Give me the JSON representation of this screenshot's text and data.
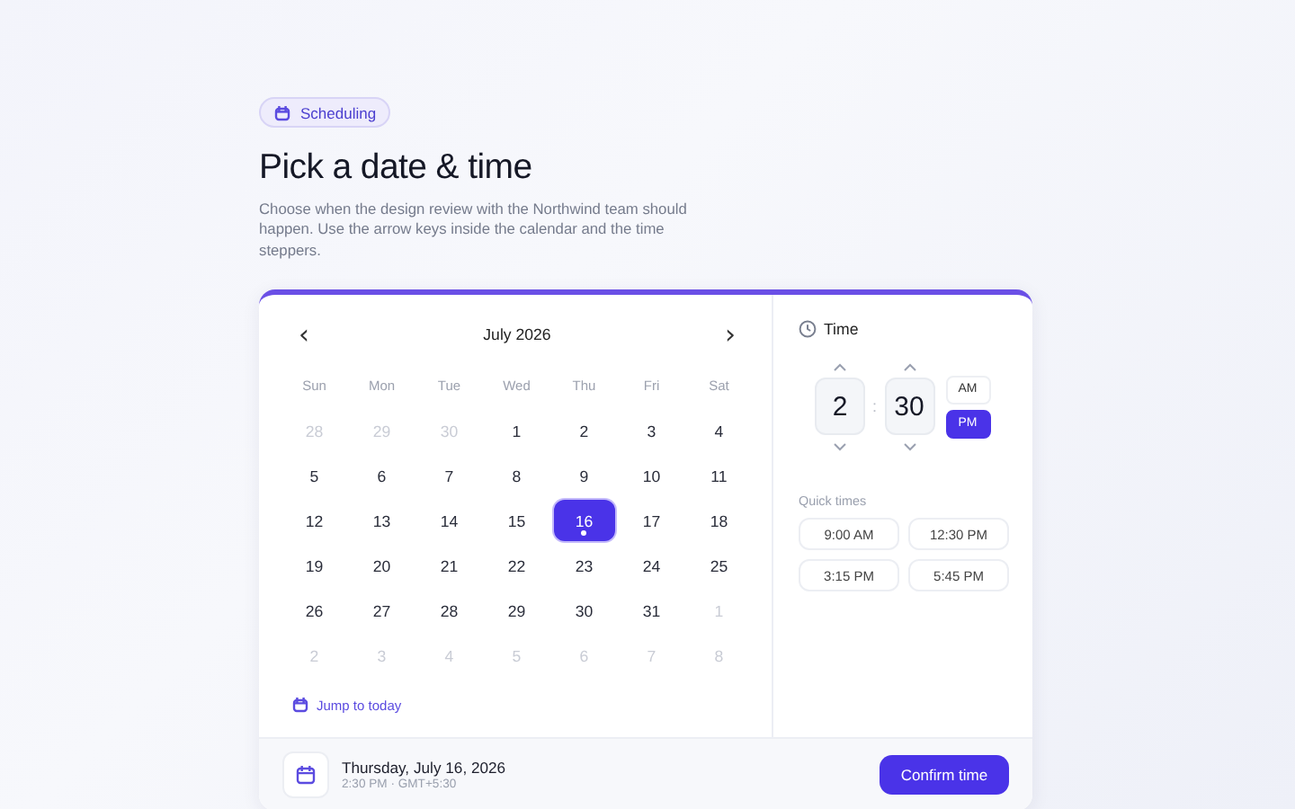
{
  "badge": {
    "label": "Scheduling"
  },
  "title": "Pick a date & time",
  "description": "Choose when the design review with the Northwind team should happen. Use the arrow keys inside the calendar and the time steppers.",
  "calendar": {
    "month": "July 2026",
    "prev": "‹",
    "next": "›",
    "weekdays": [
      "Sun",
      "Mon",
      "Tue",
      "Wed",
      "Thu",
      "Fri",
      "Sat"
    ],
    "weeks": [
      [
        {
          "day": "28",
          "outside": true,
          "selected": false
        },
        {
          "day": "29",
          "outside": true,
          "selected": false
        },
        {
          "day": "30",
          "outside": true,
          "selected": false
        },
        {
          "day": "1",
          "outside": false,
          "selected": false
        },
        {
          "day": "2",
          "outside": false,
          "selected": false
        },
        {
          "day": "3",
          "outside": false,
          "selected": false
        },
        {
          "day": "4",
          "outside": false,
          "selected": false
        }
      ],
      [
        {
          "day": "5",
          "outside": false,
          "selected": false
        },
        {
          "day": "6",
          "outside": false,
          "selected": false
        },
        {
          "day": "7",
          "outside": false,
          "selected": false
        },
        {
          "day": "8",
          "outside": false,
          "selected": false
        },
        {
          "day": "9",
          "outside": false,
          "selected": false
        },
        {
          "day": "10",
          "outside": false,
          "selected": false
        },
        {
          "day": "11",
          "outside": false,
          "selected": false
        }
      ],
      [
        {
          "day": "12",
          "outside": false,
          "selected": false
        },
        {
          "day": "13",
          "outside": false,
          "selected": false
        },
        {
          "day": "14",
          "outside": false,
          "selected": false
        },
        {
          "day": "15",
          "outside": false,
          "selected": false
        },
        {
          "day": "16",
          "outside": false,
          "selected": true
        },
        {
          "day": "17",
          "outside": false,
          "selected": false
        },
        {
          "day": "18",
          "outside": false,
          "selected": false
        }
      ],
      [
        {
          "day": "19",
          "outside": false,
          "selected": false
        },
        {
          "day": "20",
          "outside": false,
          "selected": false
        },
        {
          "day": "21",
          "outside": false,
          "selected": false
        },
        {
          "day": "22",
          "outside": false,
          "selected": false
        },
        {
          "day": "23",
          "outside": false,
          "selected": false
        },
        {
          "day": "24",
          "outside": false,
          "selected": false
        },
        {
          "day": "25",
          "outside": false,
          "selected": false
        }
      ],
      [
        {
          "day": "26",
          "outside": false,
          "selected": false
        },
        {
          "day": "27",
          "outside": false,
          "selected": false
        },
        {
          "day": "28",
          "outside": false,
          "selected": false
        },
        {
          "day": "29",
          "outside": false,
          "selected": false
        },
        {
          "day": "30",
          "outside": false,
          "selected": false
        },
        {
          "day": "31",
          "outside": false,
          "selected": false
        },
        {
          "day": "1",
          "outside": true,
          "selected": false
        }
      ],
      [
        {
          "day": "2",
          "outside": true,
          "selected": false
        },
        {
          "day": "3",
          "outside": true,
          "selected": false
        },
        {
          "day": "4",
          "outside": true,
          "selected": false
        },
        {
          "day": "5",
          "outside": true,
          "selected": false
        },
        {
          "day": "6",
          "outside": true,
          "selected": false
        },
        {
          "day": "7",
          "outside": true,
          "selected": false
        },
        {
          "day": "8",
          "outside": true,
          "selected": false
        }
      ]
    ],
    "jump_link": "Jump to today"
  },
  "time": {
    "label": "Time",
    "hour": "2",
    "separator": ":",
    "minute": "30",
    "periods": [
      {
        "label": "AM",
        "selected": false
      },
      {
        "label": "PM",
        "selected": true
      }
    ],
    "quick_label": "Quick times",
    "quick_times": [
      "9:00 AM",
      "12:30 PM",
      "3:15 PM",
      "5:45 PM"
    ]
  },
  "footer": {
    "date": "Thursday, July 16, 2026",
    "detail": "2:30 PM · GMT+5:30",
    "confirm": "Confirm time"
  }
}
